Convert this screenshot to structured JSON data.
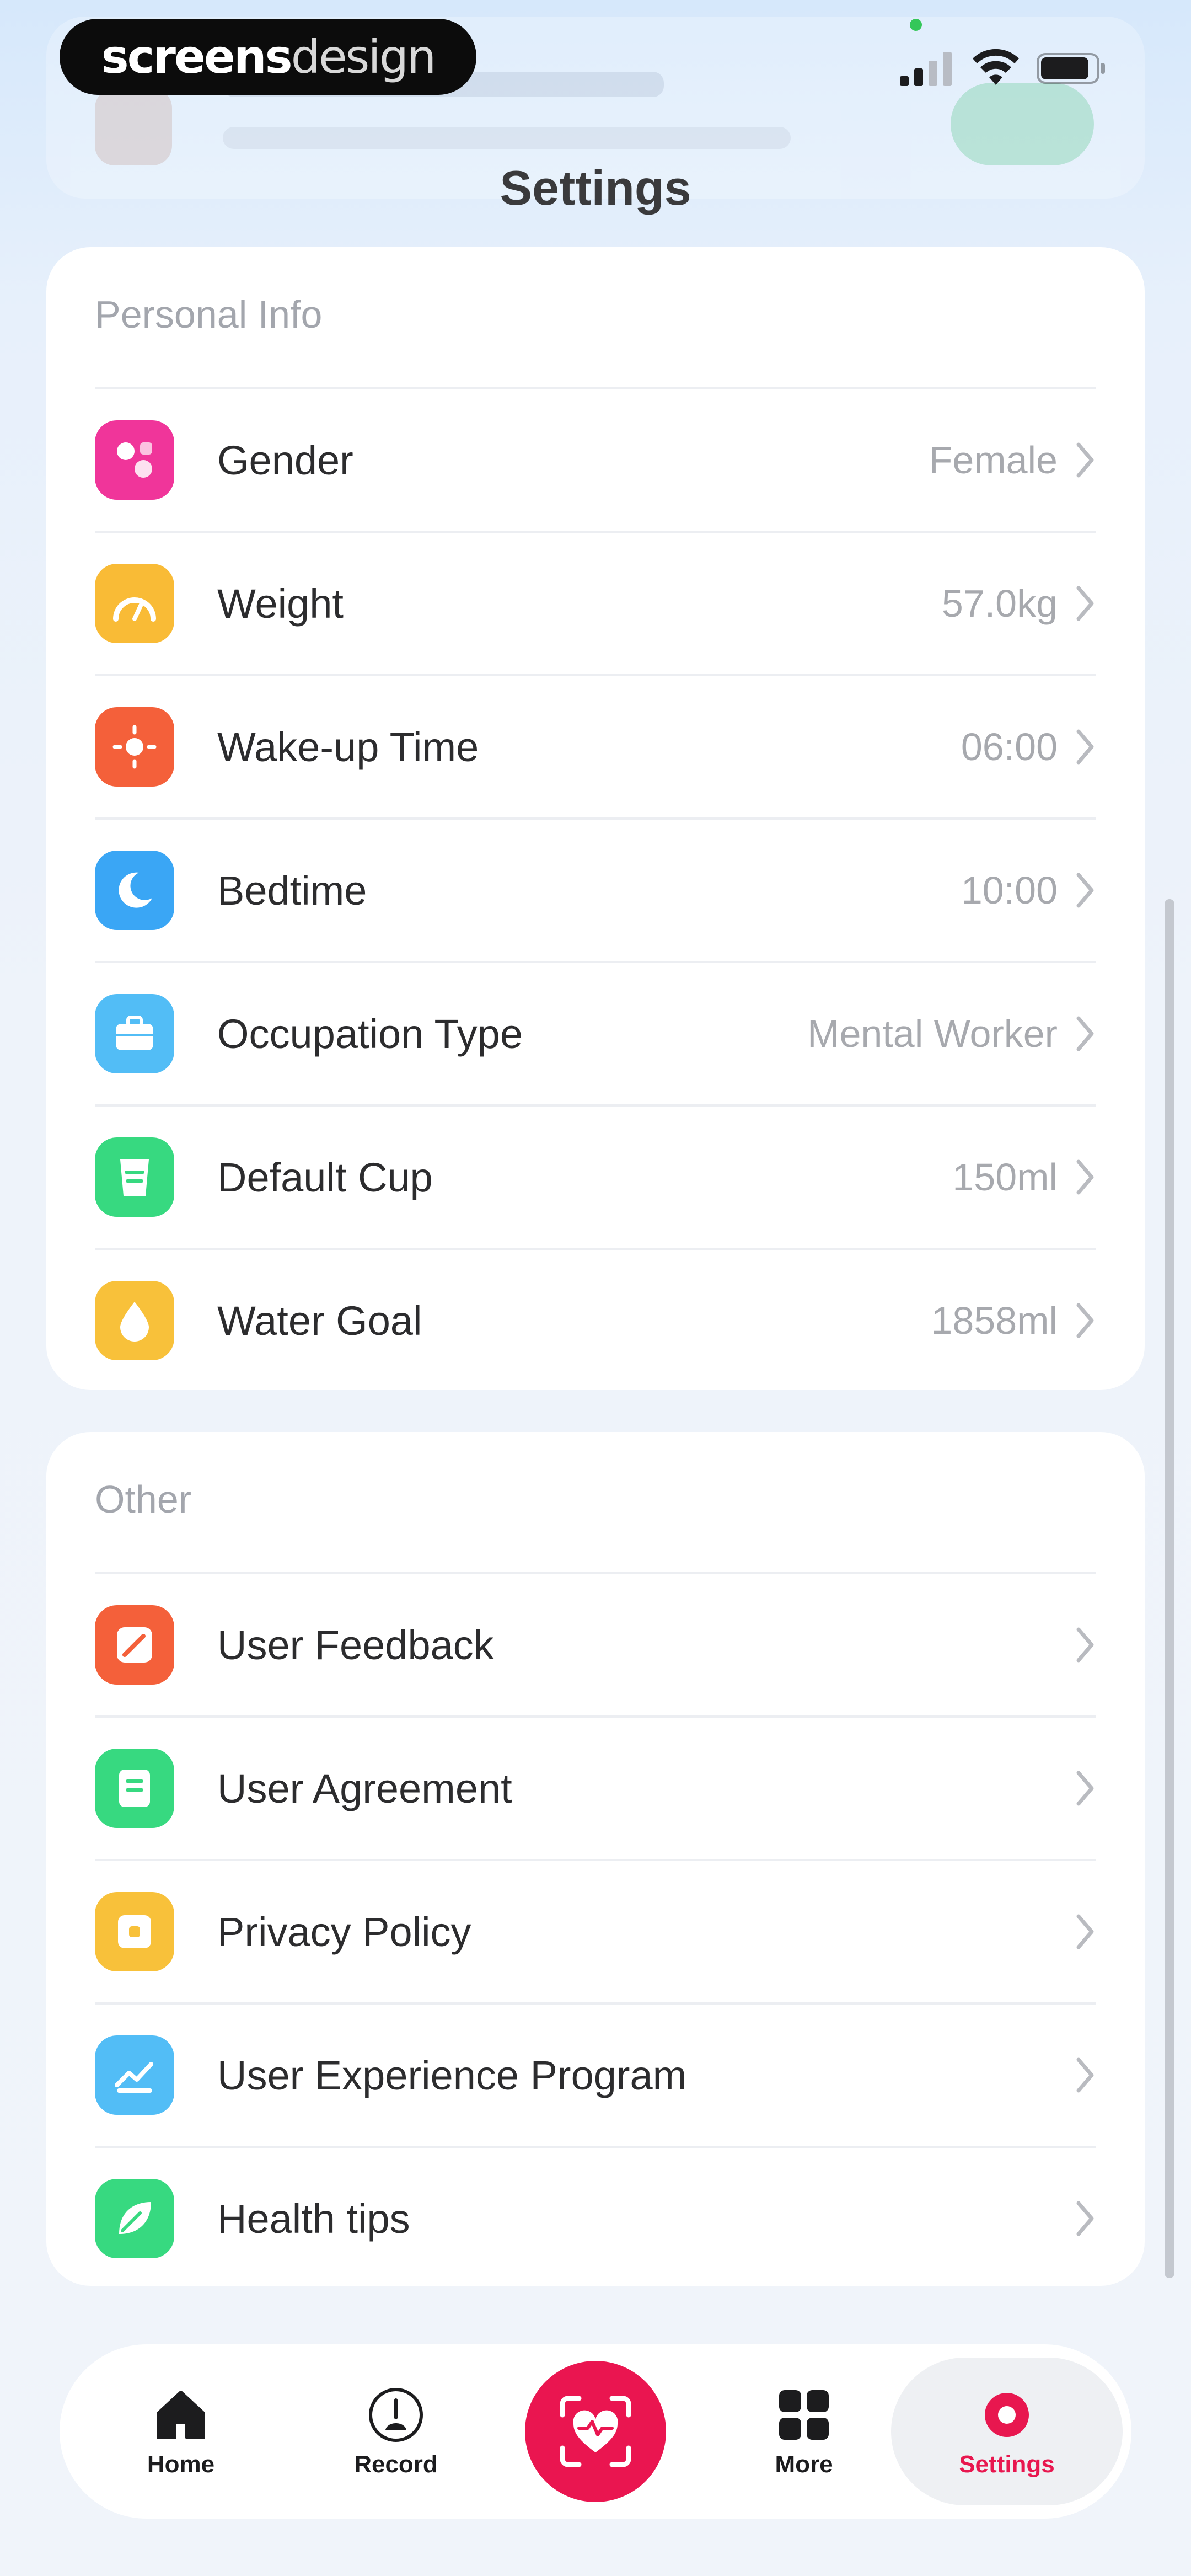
{
  "status_bar": {
    "watermark_bold": "screens",
    "watermark_thin": "design"
  },
  "header": {
    "title": "Settings"
  },
  "personal_info": {
    "section_title": "Personal Info",
    "items": [
      {
        "label": "Gender",
        "value": "Female",
        "icon": "gender-icon",
        "color": "#f0359a"
      },
      {
        "label": "Weight",
        "value": "57.0kg",
        "icon": "scale-icon",
        "color": "#f9bb36"
      },
      {
        "label": "Wake-up Time",
        "value": "06:00",
        "icon": "sun-icon",
        "color": "#f4603a"
      },
      {
        "label": "Bedtime",
        "value": "10:00",
        "icon": "moon-icon",
        "color": "#3aa6f5"
      },
      {
        "label": "Occupation Type",
        "value": "Mental Worker",
        "icon": "briefcase-icon",
        "color": "#52bdf6"
      },
      {
        "label": "Default Cup",
        "value": "150ml",
        "icon": "cup-icon",
        "color": "#37d980"
      },
      {
        "label": "Water Goal",
        "value": "1858ml",
        "icon": "water-drop-icon",
        "color": "#f8c13a"
      }
    ]
  },
  "other": {
    "section_title": "Other",
    "items": [
      {
        "label": "User Feedback",
        "icon": "feedback-icon",
        "color": "#f4603a"
      },
      {
        "label": "User Agreement",
        "icon": "document-icon",
        "color": "#37d980"
      },
      {
        "label": "Privacy Policy",
        "icon": "lock-icon",
        "color": "#f8c13a"
      },
      {
        "label": "User Experience Program",
        "icon": "chart-up-icon",
        "color": "#52bdf6"
      },
      {
        "label": "Health tips",
        "icon": "leaf-icon",
        "color": "#37d980"
      }
    ]
  },
  "tab_bar": {
    "home": "Home",
    "record": "Record",
    "more": "More",
    "settings": "Settings",
    "active_color": "#e8174f",
    "center_color": "#ea1550"
  }
}
